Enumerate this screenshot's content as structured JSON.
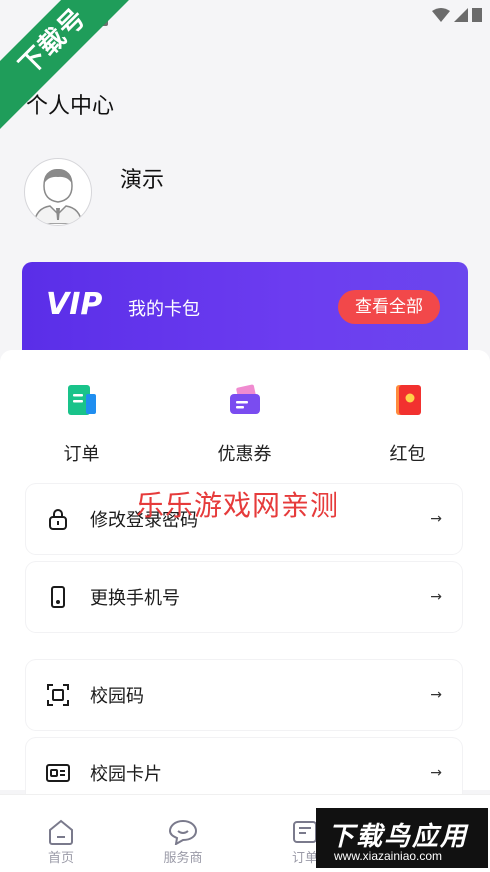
{
  "corner_banner": "下载号",
  "header": {
    "title": "个人中心"
  },
  "profile": {
    "name": "演示"
  },
  "vip": {
    "logo_text": "VIP",
    "title": "我的卡包",
    "button": "查看全部"
  },
  "quick_actions": [
    {
      "label": "订单",
      "icon": "order-icon"
    },
    {
      "label": "优惠券",
      "icon": "coupon-icon"
    },
    {
      "label": "红包",
      "icon": "red-envelope-icon"
    }
  ],
  "menu": [
    {
      "label": "修改登录密码",
      "icon": "lock-icon",
      "arrow": "→"
    },
    {
      "label": "更换手机号",
      "icon": "phone-icon",
      "arrow": "→"
    },
    {
      "label": "校园码",
      "icon": "scan-icon",
      "arrow": "→"
    },
    {
      "label": "校园卡片",
      "icon": "id-card-icon",
      "arrow": "→"
    }
  ],
  "watermark": "乐乐游戏网亲测",
  "tabs": [
    {
      "label": "首页",
      "icon": "home-icon"
    },
    {
      "label": "服务商",
      "icon": "chat-icon"
    },
    {
      "label": "订单",
      "icon": "order-tab-icon"
    }
  ],
  "brand": {
    "main": "下载鸟应用",
    "url": "www.xiazainiao.com"
  },
  "colors": {
    "vip": "#5a2ee8",
    "accent_red": "#f2484a",
    "banner_green": "#1f9d5a"
  }
}
